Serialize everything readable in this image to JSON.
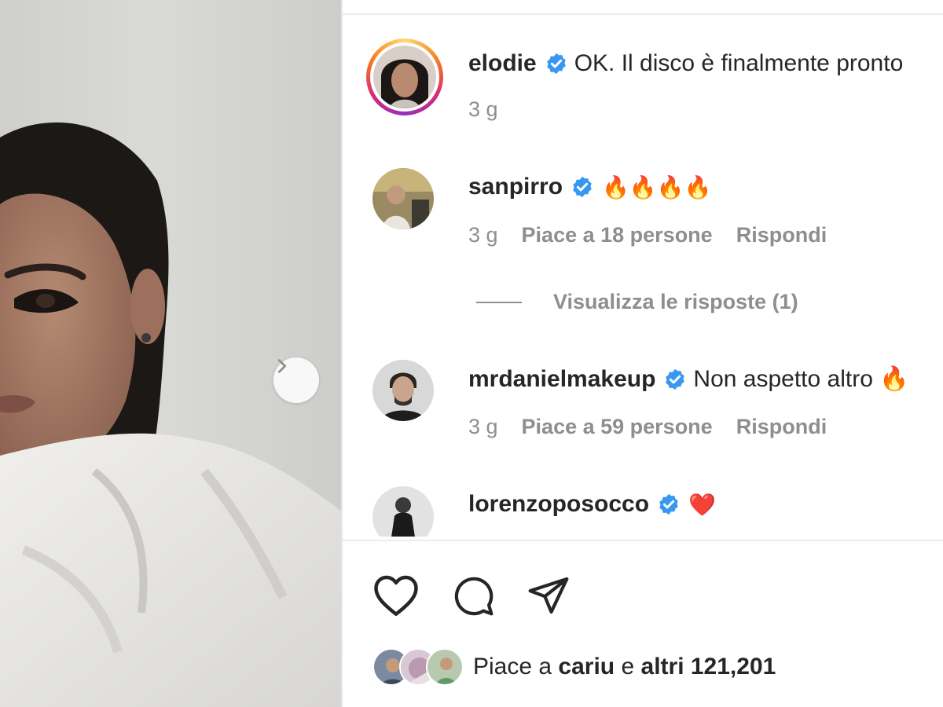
{
  "post": {
    "author": "elodie",
    "caption": "OK. Il disco è finalmente pronto",
    "time": "3 g"
  },
  "comments": [
    {
      "user": "sanpirro",
      "text": "🔥🔥🔥🔥",
      "time": "3 g",
      "likes": "Piace a 18 persone",
      "reply": "Rispondi"
    },
    {
      "user": "mrdanielmakeup",
      "text": "Non aspetto altro 🔥",
      "time": "3 g",
      "likes": "Piace a 59 persone",
      "reply": "Rispondi"
    },
    {
      "user": "lorenzoposocco",
      "text": "❤️"
    }
  ],
  "view_replies": "Visualizza le risposte (1)",
  "actions": {
    "like_icon": "heart-icon",
    "comment_icon": "comment-icon",
    "share_icon": "paper-plane-icon"
  },
  "likes_summary": {
    "prefix": "Piace a",
    "user": "cariu",
    "middle": "e",
    "rest": "altri 121,201"
  },
  "colors": {
    "verified": "#3897f0",
    "muted": "#8e8e8e",
    "text": "#262626"
  }
}
